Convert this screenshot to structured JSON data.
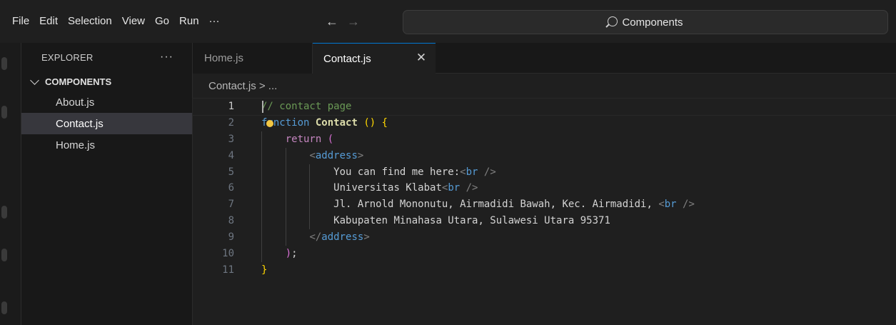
{
  "menu": [
    "File",
    "Edit",
    "Selection",
    "View",
    "Go",
    "Run",
    "···"
  ],
  "nav": {
    "back": "←",
    "forward": "→"
  },
  "command_center": {
    "label": "Components"
  },
  "sidebar": {
    "title": "EXPLORER",
    "more": "···",
    "folder": "COMPONENTS",
    "files": [
      "About.js",
      "Contact.js",
      "Home.js"
    ],
    "active_file": "Contact.js"
  },
  "tabs": [
    {
      "label": "Home.js",
      "active": false
    },
    {
      "label": "Contact.js",
      "active": true
    }
  ],
  "tab_close": "✕",
  "breadcrumb": "Contact.js > ...",
  "code": {
    "current_line": 1,
    "lines": [
      {
        "n": "1",
        "indent": 0,
        "tokens": [
          [
            "comment",
            "// contact page"
          ]
        ]
      },
      {
        "n": "2",
        "indent": 0,
        "tokens": [
          [
            "kw",
            "function"
          ],
          [
            "text",
            " "
          ],
          [
            "fn",
            "Contact"
          ],
          [
            "text",
            " "
          ],
          [
            "br1",
            "() {"
          ]
        ]
      },
      {
        "n": "3",
        "indent": 1,
        "tokens": [
          [
            "ctrl",
            "return"
          ],
          [
            "text",
            " "
          ],
          [
            "br2",
            "("
          ]
        ]
      },
      {
        "n": "4",
        "indent": 2,
        "tokens": [
          [
            "punc",
            "<"
          ],
          [
            "tag",
            "address"
          ],
          [
            "punc",
            ">"
          ]
        ]
      },
      {
        "n": "5",
        "indent": 3,
        "tokens": [
          [
            "text",
            "You can find me here:"
          ],
          [
            "punc",
            "<"
          ],
          [
            "tag",
            "br"
          ],
          [
            "text",
            " "
          ],
          [
            "punc",
            "/>"
          ]
        ]
      },
      {
        "n": "6",
        "indent": 3,
        "tokens": [
          [
            "text",
            "Universitas Klabat"
          ],
          [
            "punc",
            "<"
          ],
          [
            "tag",
            "br"
          ],
          [
            "text",
            " "
          ],
          [
            "punc",
            "/>"
          ]
        ]
      },
      {
        "n": "7",
        "indent": 3,
        "tokens": [
          [
            "text",
            "Jl. Arnold Mononutu, Airmadidi Bawah, Kec. Airmadidi, "
          ],
          [
            "punc",
            "<"
          ],
          [
            "tag",
            "br"
          ],
          [
            "text",
            " "
          ],
          [
            "punc",
            "/>"
          ]
        ]
      },
      {
        "n": "8",
        "indent": 3,
        "tokens": [
          [
            "text",
            "Kabupaten Minahasa Utara, Sulawesi Utara 95371"
          ]
        ]
      },
      {
        "n": "9",
        "indent": 2,
        "tokens": [
          [
            "punc",
            "</"
          ],
          [
            "tag",
            "address"
          ],
          [
            "punc",
            ">"
          ]
        ]
      },
      {
        "n": "10",
        "indent": 1,
        "tokens": [
          [
            "br2",
            ")"
          ],
          [
            "text",
            ";"
          ]
        ]
      },
      {
        "n": "11",
        "indent": 0,
        "tokens": [
          [
            "br1",
            "}"
          ]
        ]
      }
    ]
  },
  "colors": {
    "accent": "#0078d4",
    "comment": "#6a9955",
    "keyword": "#569cd6",
    "function": "#dcdcaa",
    "bracket_gold": "#ffd700",
    "bracket_purple": "#da70d6",
    "lightbulb": "#f2c744"
  }
}
